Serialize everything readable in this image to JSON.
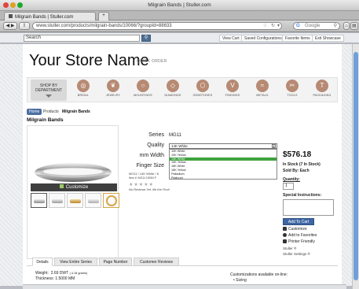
{
  "window": {
    "title": "Milgrain Bands | Stuller.com"
  },
  "tabs": [
    {
      "label": "Milgrain Bands | Stuller.com"
    },
    {
      "label": "+"
    }
  ],
  "toolbar": {
    "url": "www.stuller.com/products/milgrain-bands/10066/?groupId=88633",
    "search_engine_placeholder": "Google"
  },
  "sitebar": {
    "search_placeholder": "Search",
    "links": [
      "View Cart",
      "Saved Configurations",
      "Favorite Items",
      "Exit Showcase"
    ]
  },
  "store": {
    "name": "Your Store Name",
    "quick_order": "QUICK ORDER"
  },
  "department": {
    "line1": "SHOP BY",
    "line2": "DEPARTMENT"
  },
  "categories": [
    {
      "label": "BRIDAL",
      "icon": "ring-icon"
    },
    {
      "label": "JEWELRY",
      "icon": "necklace-icon"
    },
    {
      "label": "MOUNTINGS",
      "icon": "mounting-icon"
    },
    {
      "label": "DIAMONDS",
      "icon": "diamond-icon"
    },
    {
      "label": "GEMSTONES",
      "icon": "gemstone-icon"
    },
    {
      "label": "FINDINGS",
      "icon": "findings-icon"
    },
    {
      "label": "METALS",
      "icon": "metals-icon"
    },
    {
      "label": "TOOLS",
      "icon": "tools-icon"
    },
    {
      "label": "PACKAGING",
      "icon": "packaging-icon"
    }
  ],
  "breadcrumb": [
    "Home",
    "Products",
    "Milgrain Bands"
  ],
  "product": {
    "title": "Milgrain Bands",
    "customize_label": "Customize",
    "specs": {
      "series_label": "Series",
      "series_value": "MG11",
      "quality_label": "Quality",
      "quality_value": "14K White",
      "width_label": "mm Width",
      "finger_label": "Finger Size"
    },
    "quality_options": [
      "10K White",
      "10K Yellow",
      "14K White",
      "14K Yellow",
      "18K White",
      "18K Yellow",
      "Palladium",
      "Platinum"
    ],
    "selected_option": "14K White",
    "summary_line1": "MG11 / 14K White / 6",
    "summary_line2": "Item #: MG11:15064 P",
    "reviews_text": "No Reviews Yet.",
    "reviews_link": "Be the First!",
    "stars": "★★★★★"
  },
  "purchase": {
    "price": "$576.18",
    "stock": "In Stock (7 In Stock)",
    "sold_by": "Sold By: Each",
    "quantity_label": "Quantity:",
    "quantity_value": "1",
    "instructions_label": "Special Instructions:",
    "add_to_cart": "Add To Cart",
    "customize": "Customize",
    "add_favorites": "Add to Favorites",
    "printer_friendly": "Printer Friendly",
    "stuller_link": "Stuller ®",
    "stuller_settings": "Stuller Settings ®"
  },
  "product_tabs": [
    "Details",
    "View Entire Series",
    "Page Number",
    "Customer Reviews"
  ],
  "details": {
    "weight_label": "Weight:",
    "weight_value": "2.69 DWT",
    "weight_grams": "( 4.18 grams)",
    "thickness_label": "Thickness:",
    "thickness_value": "1.5000 MM",
    "customizations": "Customizations available on-line:",
    "customization_first": "• Sizing"
  },
  "colors": {
    "accent": "#3f66a3",
    "category_icon": "#b78a74",
    "selected_option": "#3fa23f"
  }
}
